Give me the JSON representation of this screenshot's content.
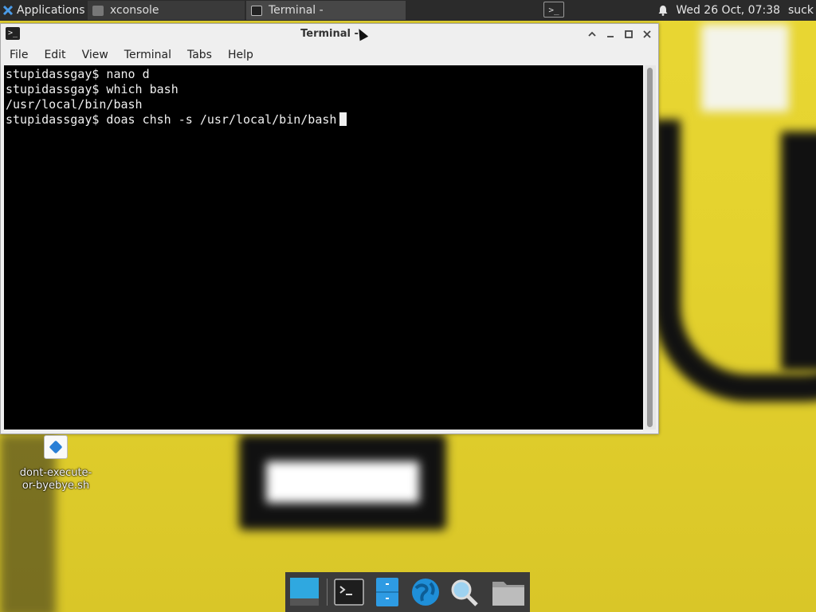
{
  "top_panel": {
    "apps_label": "Applications",
    "apps_suffix": "☰",
    "tasks": [
      {
        "label": "xconsole"
      },
      {
        "label": "Terminal -"
      }
    ],
    "clock": "Wed 26 Oct, 07:38",
    "user": "suck"
  },
  "window": {
    "title": "Terminal -",
    "menus": [
      "File",
      "Edit",
      "View",
      "Terminal",
      "Tabs",
      "Help"
    ]
  },
  "terminal": {
    "lines": [
      "stupidassgay$ nano d",
      "stupidassgay$ which bash",
      "/usr/local/bin/bash",
      "stupidassgay$ doas chsh -s /usr/local/bin/bash"
    ]
  },
  "desktop": {
    "file_label": "dont-execute-or-byebye.sh"
  },
  "dock": {
    "items": [
      "show-desktop",
      "terminal",
      "file-manager",
      "web-browser",
      "app-finder",
      "home-folder"
    ]
  },
  "colors": {
    "panel_bg": "#2b2b2b",
    "terminal_bg": "#000000",
    "terminal_fg": "#f0f0f0",
    "window_chrome": "#efefef",
    "wallpaper_yellow": "#e4d22e"
  }
}
